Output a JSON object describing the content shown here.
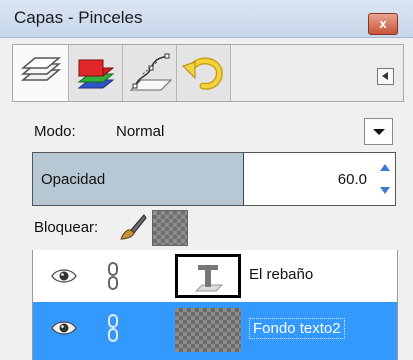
{
  "window": {
    "title": "Capas - Pinceles",
    "close_glyph": "x"
  },
  "tabs": [
    {
      "icon": "layers-icon",
      "active": true
    },
    {
      "icon": "channels-icon",
      "active": false
    },
    {
      "icon": "paths-icon",
      "active": false
    },
    {
      "icon": "undo-history-icon",
      "active": false
    }
  ],
  "mode": {
    "label": "Modo:",
    "value": "Normal"
  },
  "opacity": {
    "label": "Opacidad",
    "value": "60.0",
    "fraction": 0.6
  },
  "lock": {
    "label": "Bloquear:"
  },
  "layers": [
    {
      "name": "El rebaño",
      "visible": true,
      "selected": false,
      "thumbnail": "text-layer-icon"
    },
    {
      "name": "Fondo texto2",
      "visible": true,
      "selected": true,
      "thumbnail": "transparent-checker"
    }
  ],
  "colors": {
    "selection": "#3399ff",
    "opacity_fill": "#b7c7d3"
  }
}
